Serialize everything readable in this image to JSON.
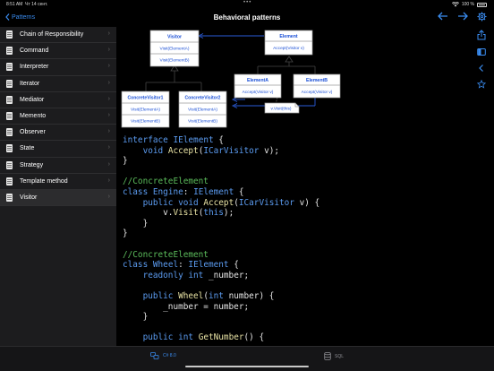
{
  "status": {
    "time": "8:51 AM",
    "date": "Чт 14 сент.",
    "battery": "100 %"
  },
  "nav": {
    "back_label": "Patterns",
    "title": "Behavioral patterns"
  },
  "sidebar": {
    "items": [
      {
        "label": "Chain of Responsibility"
      },
      {
        "label": "Command"
      },
      {
        "label": "Interpreter"
      },
      {
        "label": "Iterator"
      },
      {
        "label": "Mediator"
      },
      {
        "label": "Memento"
      },
      {
        "label": "Observer"
      },
      {
        "label": "State"
      },
      {
        "label": "Strategy"
      },
      {
        "label": "Template method"
      },
      {
        "label": "Visitor"
      }
    ],
    "active_index": 10
  },
  "diagram": {
    "visitor": {
      "title": "Visitor",
      "methods": [
        "Visit(ElementA)",
        "Visit(ElementB)"
      ]
    },
    "element": {
      "title": "Element",
      "methods": [
        "Accept(Visitor v)"
      ]
    },
    "concrete1": {
      "title": "ConcreteVisitor1",
      "methods": [
        "Visit(ElementA)",
        "Visit(ElementB)"
      ]
    },
    "concrete2": {
      "title": "ConcreteVisitor2",
      "methods": [
        "Visit(ElementA)",
        "Visit(ElementB)"
      ]
    },
    "elementA": {
      "title": "ElementA",
      "methods": [
        "Accept(Visitor v)"
      ]
    },
    "elementB": {
      "title": "ElementB",
      "methods": [
        "Accept(Visitor v)"
      ]
    },
    "note": "v.Visit(this)",
    "colors": {
      "title": "#1a4fd6",
      "box_border": "#9a9a9a",
      "line": "#2a5bd8",
      "dark_line": "#444444"
    }
  },
  "code": {
    "l1_kw": "interface",
    "l1_name": "IElement",
    "l1_brace": " {",
    "l2_kw": "void",
    "l2_fn": "Accept",
    "l2_type": "ICarVisitor",
    "l2_rest": " v);",
    "l3": "}",
    "l5": "//ConcreteElement",
    "l6_kw": "class",
    "l6_name": "Engine",
    "l6_sep": ": ",
    "l6_iface": "IElement",
    "l6_brace": " {",
    "l7_kw1": "public",
    "l7_kw2": "void",
    "l7_fn": "Accept",
    "l7_type": "ICarVisitor",
    "l7_rest": " v) {",
    "l8_obj": "v.",
    "l8_fn": "Visit",
    "l8_kw": "this",
    "l8_rest": ");",
    "l9": "}",
    "l10": "}",
    "l12": "//ConcreteElement",
    "l13_kw": "class",
    "l13_name": "Wheel",
    "l13_sep": ": ",
    "l13_iface": "IElement",
    "l13_brace": " {",
    "l14_kw1": "readonly",
    "l14_kw2": "int",
    "l14_rest": " _number;",
    "l16_kw1": "public",
    "l16_fn": "Wheel",
    "l16_kw2": "int",
    "l16_rest": " number) {",
    "l17": "_number = number;",
    "l18": "}",
    "l20_kw1": "public",
    "l20_kw2": "int",
    "l20_fn": "GetNumber",
    "l20_rest": "() {"
  },
  "bottom_tabs": {
    "csharp_label": "C# 8.0",
    "sql_label": "SQL"
  },
  "colors": {
    "accent": "#3a8cf0",
    "keyword": "#5b9bf0",
    "comment": "#5cbd5c",
    "function": "#e8e2a4"
  }
}
